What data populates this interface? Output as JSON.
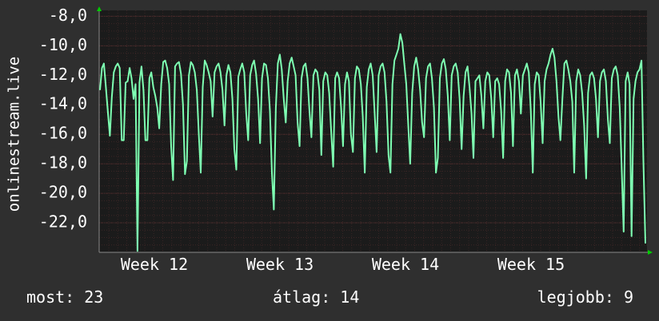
{
  "chart_data": {
    "type": "line",
    "ylabel": "onlinestream.live",
    "y_ticks": [
      "-8,0",
      "-10,0",
      "-12,0",
      "-14,0",
      "-16,0",
      "-18,0",
      "-20,0",
      "-22,0"
    ],
    "x_ticks": [
      "Week 12",
      "Week 13",
      "Week 14",
      "Week 15"
    ],
    "ylim": [
      -24.0,
      -7.6
    ],
    "grid": true,
    "colors": {
      "line": "#7effb2",
      "background": "#1b1b1b",
      "grid": "#4a2a2a",
      "axis_arrow": "#00cc00"
    },
    "series": [
      {
        "values": [
          -13,
          -11.5,
          -11.2,
          -12.8,
          -14.5,
          -16.1,
          -13.5,
          -11.8,
          -11.4,
          -11.2,
          -11.5,
          -16.4,
          -16.4,
          -12.5,
          -12.4,
          -11.5,
          -12.2,
          -13.6,
          -12.6,
          -23.9,
          -12.5,
          -11.4,
          -13,
          -16.4,
          -16.4,
          -12.2,
          -11.8,
          -12.8,
          -13.4,
          -14.2,
          -15.6,
          -12.6,
          -11.1,
          -11.0,
          -11.5,
          -12.6,
          -16.8,
          -19.1,
          -11.4,
          -11.2,
          -11.1,
          -11.9,
          -14.0,
          -18.7,
          -17.8,
          -12.0,
          -11.1,
          -11.3,
          -11.8,
          -13.0,
          -16.0,
          -18.6,
          -12.8,
          -11.0,
          -11.3,
          -11.8,
          -12.4,
          -14.8,
          -11.8,
          -11.4,
          -11.2,
          -11.8,
          -13.0,
          -15.4,
          -12.0,
          -11.3,
          -11.8,
          -13.6,
          -17.0,
          -18.4,
          -12.1,
          -11.6,
          -11.2,
          -11.8,
          -14.6,
          -16.4,
          -12.0,
          -11.3,
          -11.0,
          -11.9,
          -13.6,
          -16.6,
          -12.2,
          -11.2,
          -11.3,
          -12.2,
          -14.4,
          -18.6,
          -21.1,
          -14.2,
          -11.2,
          -10.6,
          -11.6,
          -13.6,
          -15.2,
          -12.4,
          -11.2,
          -10.8,
          -11.4,
          -12.0,
          -15.2,
          -16.8,
          -12.2,
          -11.4,
          -11.2,
          -12.2,
          -14.4,
          -16.2,
          -12.0,
          -11.6,
          -11.8,
          -13.0,
          -17.4,
          -12.4,
          -11.8,
          -12.0,
          -13.2,
          -15.8,
          -18.2,
          -12.2,
          -11.8,
          -12.2,
          -14.2,
          -16.8,
          -12.6,
          -11.8,
          -12.4,
          -16.0,
          -17.2,
          -12.2,
          -11.4,
          -11.6,
          -12.6,
          -14.8,
          -18.6,
          -12.8,
          -11.6,
          -11.2,
          -12.0,
          -14.6,
          -17.2,
          -12.0,
          -11.4,
          -11.2,
          -11.8,
          -13.8,
          -17.4,
          -18.6,
          -12.6,
          -11.0,
          -10.6,
          -10.2,
          -9.2,
          -9.8,
          -11.2,
          -12.6,
          -15.4,
          -18.0,
          -13.2,
          -11.4,
          -10.8,
          -11.6,
          -13.0,
          -15.2,
          -16.2,
          -12.2,
          -11.4,
          -11.2,
          -12.2,
          -14.2,
          -18.6,
          -17.6,
          -12.2,
          -11.2,
          -10.9,
          -11.6,
          -13.4,
          -16.4,
          -12.0,
          -11.4,
          -11.2,
          -11.8,
          -13.6,
          -17.0,
          -13.4,
          -11.8,
          -11.4,
          -12.8,
          -14.6,
          -17.6,
          -12.4,
          -12.2,
          -12.0,
          -13.4,
          -15.6,
          -12.4,
          -11.8,
          -12.0,
          -13.6,
          -16.2,
          -12.4,
          -12.2,
          -12.6,
          -14.4,
          -17.6,
          -12.4,
          -11.6,
          -11.8,
          -13.2,
          -16.8,
          -12.0,
          -11.6,
          -12.4,
          -14.6,
          -12.0,
          -11.6,
          -11.2,
          -11.8,
          -14.4,
          -18.6,
          -12.6,
          -11.8,
          -12.0,
          -13.8,
          -16.6,
          -12.4,
          -11.6,
          -11.2,
          -10.6,
          -10.2,
          -10.8,
          -12.4,
          -14.8,
          -16.4,
          -13.6,
          -11.2,
          -11.0,
          -11.6,
          -12.4,
          -13.8,
          -18.6,
          -12.4,
          -11.6,
          -12.0,
          -13.2,
          -15.4,
          -19.0,
          -13.2,
          -12.0,
          -11.8,
          -12.2,
          -13.6,
          -16.2,
          -12.4,
          -11.8,
          -11.6,
          -12.4,
          -15.0,
          -16.6,
          -12.2,
          -11.6,
          -11.4,
          -12.0,
          -14.2,
          -18.2,
          -22.6,
          -12.4,
          -11.8,
          -12.6,
          -22.9,
          -13.6,
          -12.4,
          -11.8,
          -11.6,
          -11.0,
          -17.8,
          -23.4
        ]
      }
    ]
  },
  "stats": {
    "current": "most: 23",
    "average": "átlag: 14",
    "best": "legjobb: 9"
  }
}
